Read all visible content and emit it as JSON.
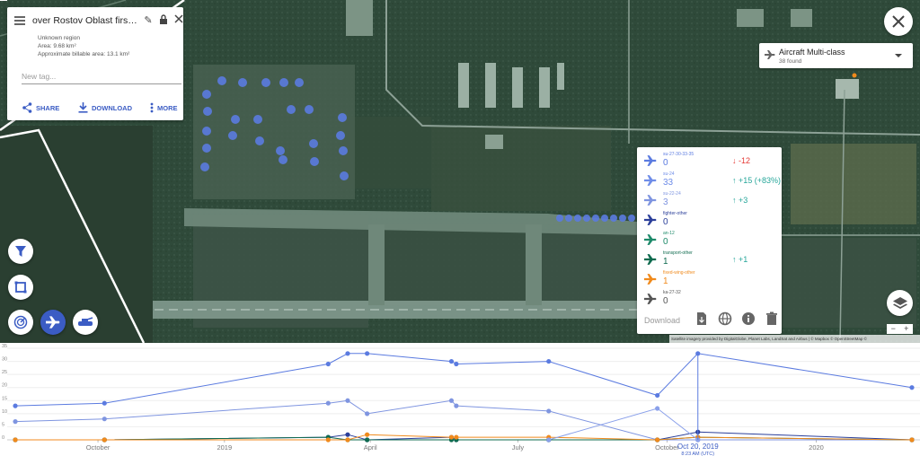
{
  "info_card": {
    "title": "over Rostov Oblast first-order...",
    "region": "Unknown region",
    "area": "Area: 9.68 km²",
    "billable_area": "Approximate billable area: 13.1 km²",
    "tag_placeholder": "New tag...",
    "share_label": "SHARE",
    "download_label": "DOWNLOAD",
    "more_label": "MORE"
  },
  "class_select": {
    "name": "Aircraft Multi-class",
    "found": "38 found"
  },
  "legend": {
    "rows": [
      {
        "label": "su-27-30-33-35",
        "count": "0",
        "delta": "-12",
        "trend": "down",
        "color": "#5b7be0",
        "delta_color": "#e53935"
      },
      {
        "label": "su-24",
        "count": "33",
        "delta": "+15 (+83%)",
        "trend": "up",
        "color": "#6f8de8",
        "delta_color": "#26a69a"
      },
      {
        "label": "su-22-24",
        "count": "3",
        "delta": "+3",
        "trend": "up",
        "color": "#7f95e0",
        "delta_color": "#26a69a"
      },
      {
        "label": "fighter-other",
        "count": "0",
        "delta": "",
        "trend": "",
        "color": "#2b3f9a",
        "delta_color": "#26a69a"
      },
      {
        "label": "an-12",
        "count": "0",
        "delta": "",
        "trend": "",
        "color": "#1e8a6a",
        "delta_color": "#26a69a"
      },
      {
        "label": "transport-other",
        "count": "1",
        "delta": "+1",
        "trend": "up",
        "color": "#0f6b4f",
        "delta_color": "#26a69a"
      },
      {
        "label": "fixed-wing-other",
        "count": "1",
        "delta": "",
        "trend": "",
        "color": "#f08a1c",
        "delta_color": "#26a69a"
      },
      {
        "label": "ka-27-32",
        "count": "0",
        "delta": "",
        "trend": "",
        "color": "#555555",
        "delta_color": "#26a69a"
      }
    ],
    "download_label": "Download"
  },
  "attribution": "Satellite imagery provided by DigitalGlobe, Planet Labs, LandSat and Airbus | © Mapbox © OpenStreetMap ©",
  "zoom": {
    "minus": "−",
    "plus": "+"
  },
  "chart_data": {
    "type": "line",
    "x_ticks": [
      "October",
      "2019",
      "April",
      "July",
      "October",
      "2020"
    ],
    "y_ticks": [
      "0",
      "5",
      "10",
      "15",
      "20",
      "25",
      "30",
      "35"
    ],
    "ylim": [
      0,
      35
    ],
    "selected_date": "Oct 20, 2019",
    "selected_time": "8:23 AM (UTC)",
    "series": [
      {
        "color": "#5b7be0",
        "x": [
          "2018-08-25",
          "2018-10-19",
          "2019-03-06",
          "2019-03-18",
          "2019-03-30",
          "2019-05-21",
          "2019-05-24",
          "2019-07-20",
          "2019-09-25",
          "2019-10-20",
          "2020-02-29"
        ],
        "values": [
          13,
          14,
          29,
          33,
          33,
          30,
          29,
          30,
          17,
          33,
          20
        ]
      },
      {
        "color": "#7f95e0",
        "x": [
          "2018-08-25",
          "2018-10-19",
          "2019-03-06",
          "2019-03-18",
          "2019-03-30",
          "2019-05-21",
          "2019-05-24",
          "2019-07-20",
          "2019-09-25",
          "2019-10-20",
          "2020-02-29"
        ],
        "values": [
          7,
          8,
          14,
          15,
          10,
          15,
          13,
          11,
          0,
          0,
          0
        ]
      },
      {
        "color": "#2b3f9a",
        "x": [
          "2018-08-25",
          "2018-10-19",
          "2019-03-06",
          "2019-03-18",
          "2019-03-30",
          "2019-05-21",
          "2019-05-24",
          "2019-07-20",
          "2019-09-25",
          "2019-10-20",
          "2020-02-29"
        ],
        "values": [
          0,
          0,
          1,
          2,
          0,
          1,
          0,
          0,
          0,
          3,
          0
        ]
      },
      {
        "color": "#0f6b4f",
        "x": [
          "2018-08-25",
          "2018-10-19",
          "2019-03-06",
          "2019-03-18",
          "2019-03-30",
          "2019-05-21",
          "2019-05-24",
          "2019-07-20",
          "2019-09-25",
          "2019-10-20",
          "2020-02-29"
        ],
        "values": [
          0,
          0,
          1,
          0,
          0,
          0,
          0,
          0,
          0,
          1,
          0
        ]
      },
      {
        "color": "#f08a1c",
        "x": [
          "2018-08-25",
          "2018-10-19",
          "2019-03-06",
          "2019-03-18",
          "2019-03-30",
          "2019-05-21",
          "2019-05-24",
          "2019-07-20",
          "2019-09-25",
          "2019-10-20",
          "2020-02-29"
        ],
        "values": [
          0,
          0,
          0,
          0,
          2,
          1,
          1,
          1,
          0,
          1,
          0
        ]
      },
      {
        "color": "#8aa0ea",
        "x": [
          "2019-07-20",
          "2019-09-25",
          "2019-10-20"
        ],
        "values": [
          0,
          12,
          0
        ]
      }
    ]
  }
}
